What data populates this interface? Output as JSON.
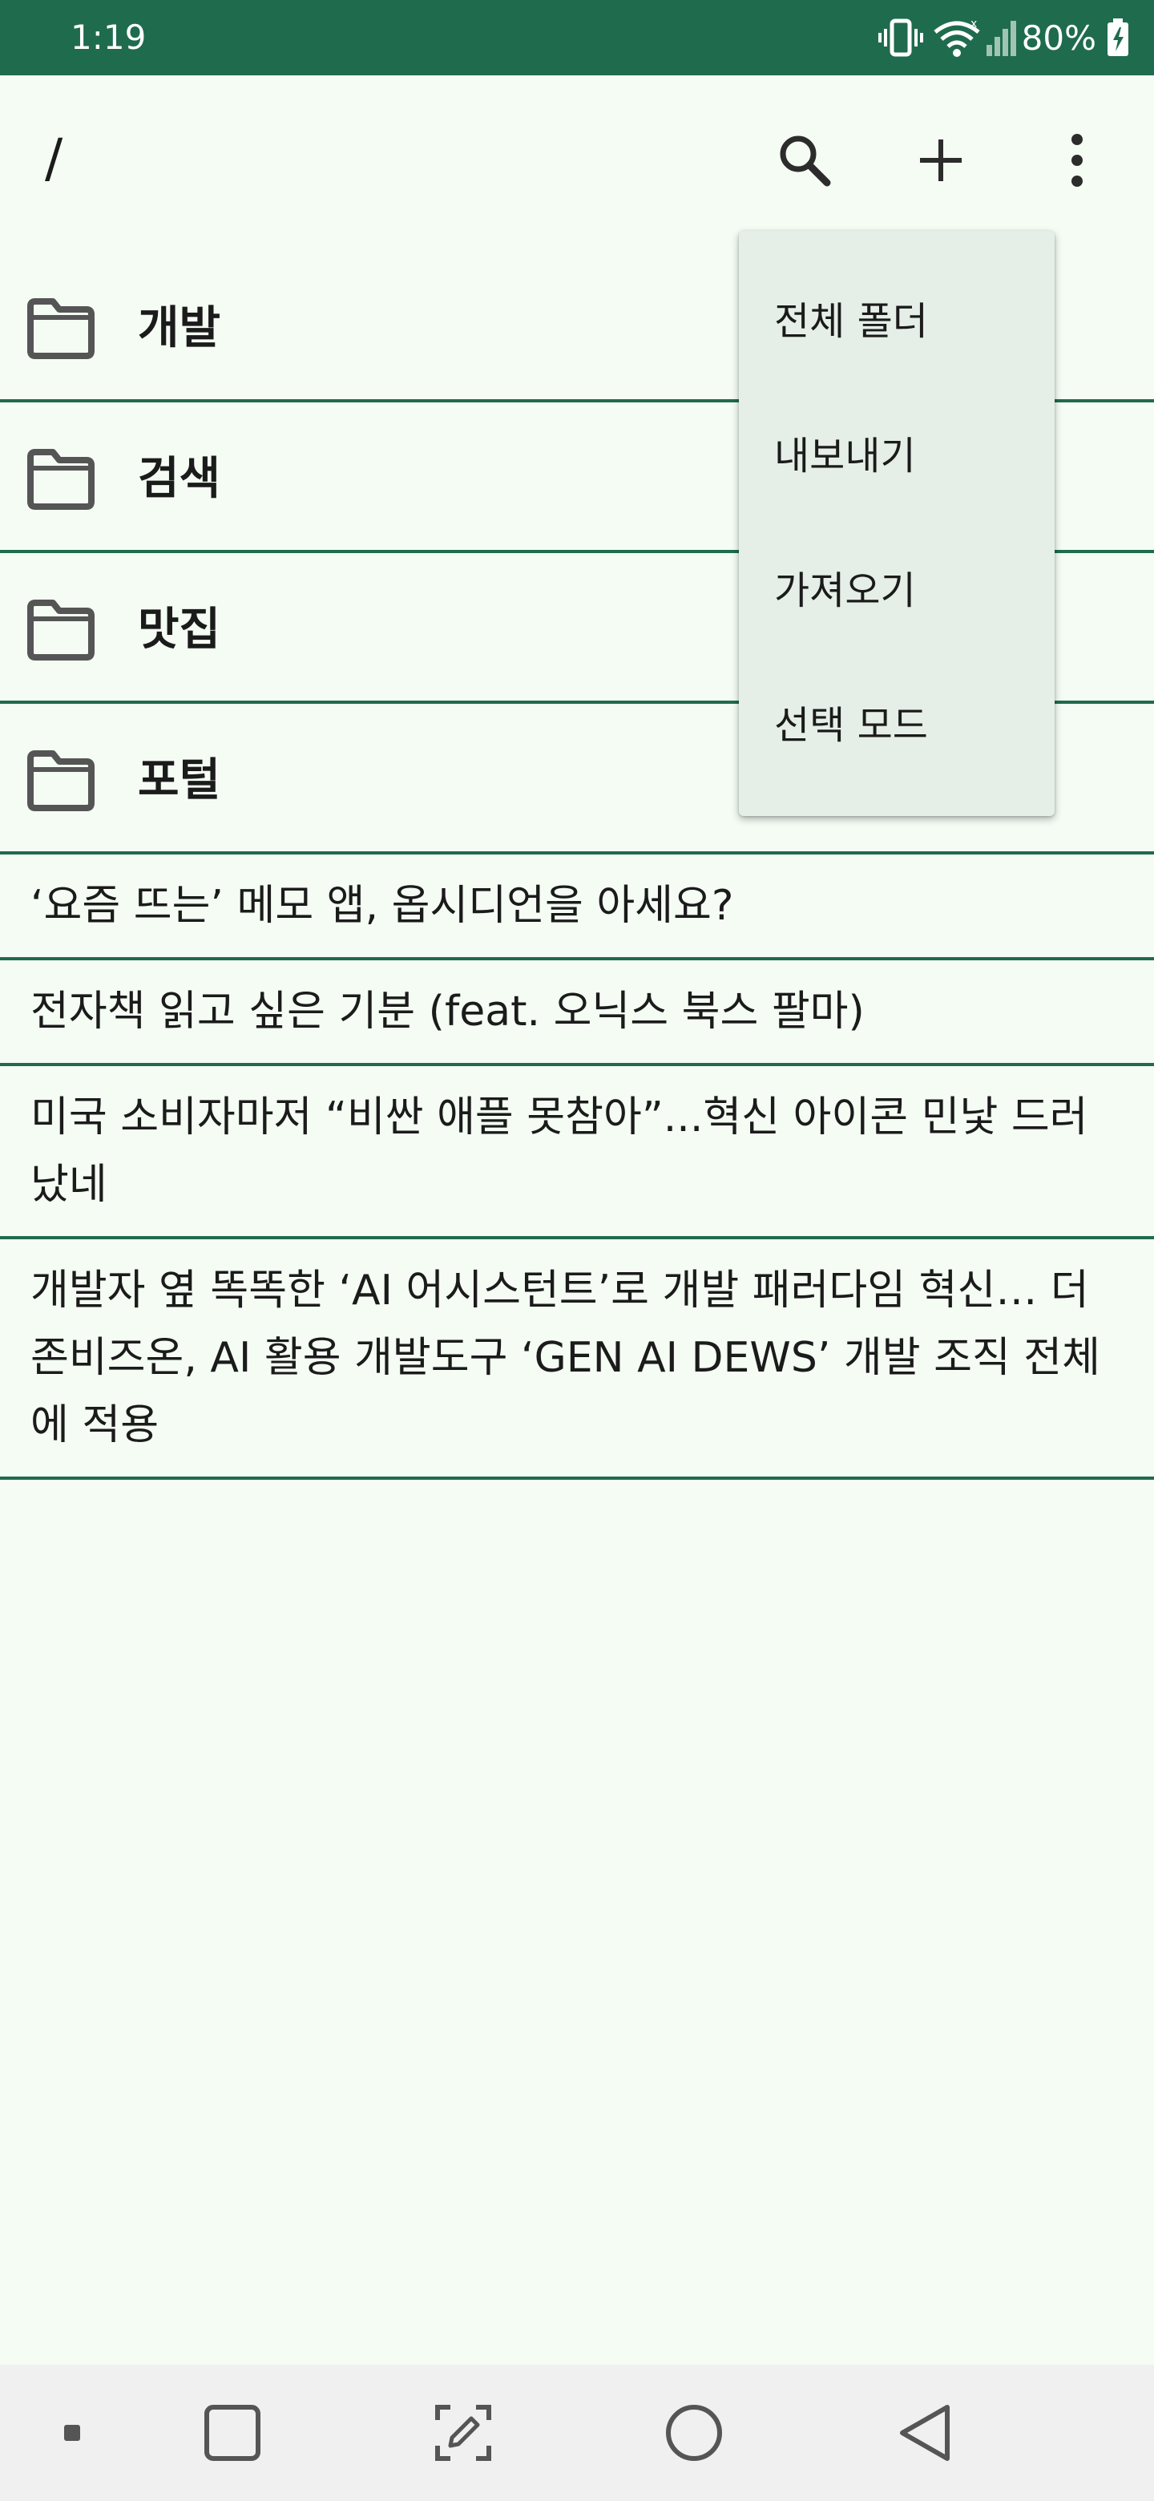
{
  "status_bar": {
    "time": "1:19",
    "battery": "80%",
    "icons": [
      "vibrate-icon",
      "wifi-icon",
      "signal-icon",
      "battery-icon"
    ]
  },
  "app_bar": {
    "path": "/",
    "actions": [
      "search-icon",
      "add-icon",
      "more-vert-icon"
    ]
  },
  "folders": [
    {
      "name": "개발",
      "icon": "folder-icon"
    },
    {
      "name": "검색",
      "icon": "folder-icon"
    },
    {
      "name": "맛집",
      "icon": "folder-icon"
    },
    {
      "name": "포털",
      "icon": "folder-icon"
    }
  ],
  "memos": [
    {
      "title": "‘요즘 뜨는’ 메모 앱, 옵시디언을 아세요?"
    },
    {
      "title": "전자책 읽고 싶은 기분 (feat. 오닉스 북스 팔마)"
    },
    {
      "title": "미국 소비자마저 “비싼 애플 못참아”...혁신 아이콘 민낯 드러났네"
    },
    {
      "title": "개발자 옆 똑똑한 ‘AI 어시스턴트’로 개발 패러다임 혁신… 더존비즈온, AI 활용 개발도구 ‘GEN AI DEWS’ 개발 조직 전체에 적용"
    }
  ],
  "overflow_menu": {
    "items": [
      "전체 폴더",
      "내보내기",
      "가져오기",
      "선택 모드"
    ]
  },
  "nav_bar": {
    "buttons": [
      "dot-icon",
      "recents-icon",
      "screenshot-edit-icon",
      "home-icon",
      "back-icon"
    ]
  },
  "colors": {
    "primary": "#1f6b4e",
    "background": "#f4fcf4",
    "menu_background": "#e5efe7",
    "nav_background": "#f0f0f0"
  }
}
